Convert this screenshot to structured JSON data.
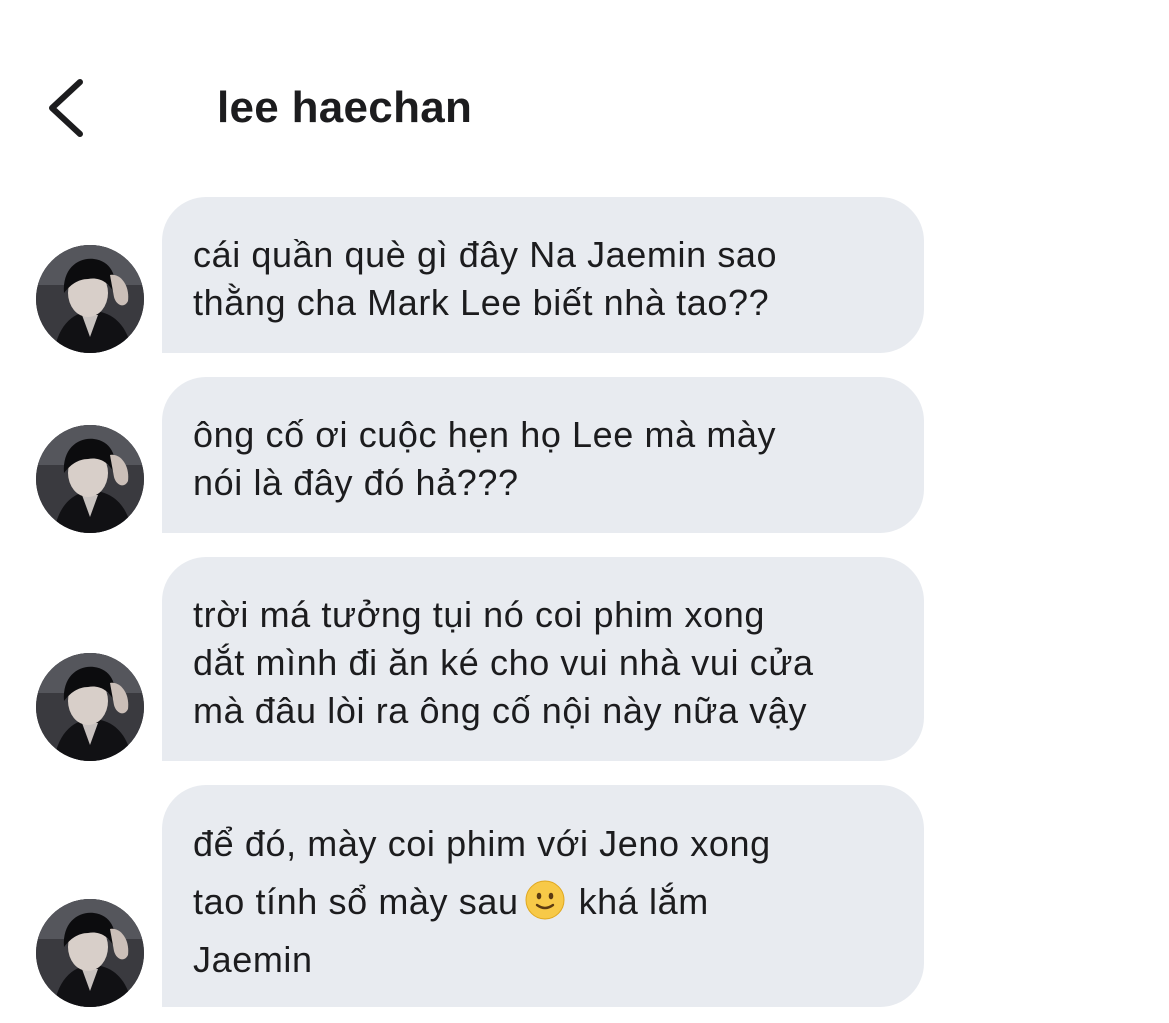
{
  "header": {
    "back_icon": "chevron-left-icon",
    "title": "lee haechan"
  },
  "messages": [
    {
      "text": "cái quần què gì đây Na Jaemin sao\nthằng cha Mark Lee biết nhà tao??"
    },
    {
      "text": "ông cố ơi cuộc hẹn họ Lee mà mày\nnói là đây đó hả???"
    },
    {
      "text": "trời má tưởng tụi nó coi phim xong\ndắt mình đi ăn ké cho vui nhà vui cửa\nmà đâu lòi ra ông cố nội này nữa vậy"
    },
    {
      "text_before": "để đó, mày coi phim với Jeno xong\ntao tính sổ mày sau",
      "emoji": "slightly-smiling-face-emoji",
      "text_after": "khá lắm\nJaemin"
    }
  ],
  "colors": {
    "bubble_bg": "#e8ebf0",
    "text": "#1c1c1e",
    "background": "#ffffff"
  }
}
